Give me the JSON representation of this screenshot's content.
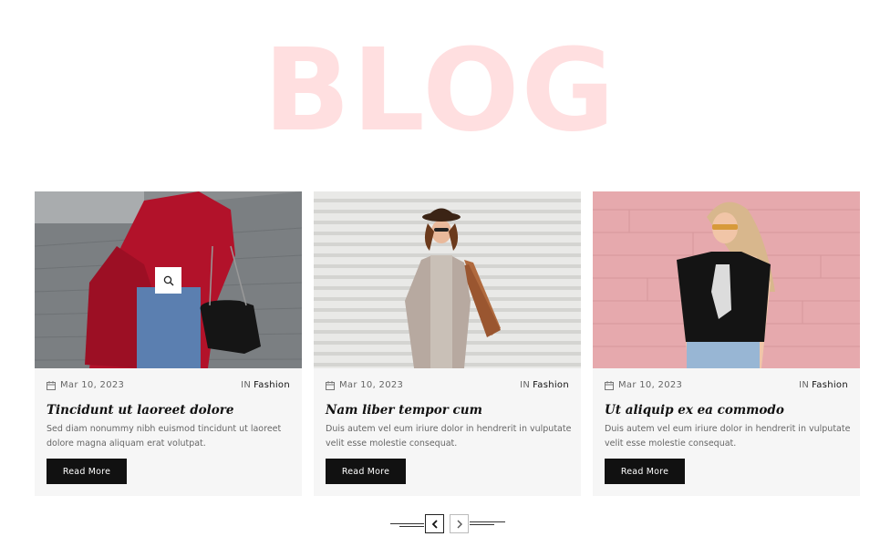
{
  "hero": {
    "title": "BLOG"
  },
  "posts": [
    {
      "date": "Mar 10, 2023",
      "in_label": "IN",
      "category": "Fashion",
      "title": "Tincidunt ut laoreet dolore",
      "excerpt": "Sed diam nonummy nibh euismod tincidunt ut laoreet dolore magna aliquam erat volutpat.",
      "button": "Read More",
      "image": "woman-red-coat-photo",
      "zoom_icon": "search-icon"
    },
    {
      "date": "Mar 10, 2023",
      "in_label": "IN",
      "category": "Fashion",
      "title": "Nam liber tempor cum",
      "excerpt": "Duis autem vel eum iriure dolor in hendrerit in vulputate velit esse molestie consequat.",
      "button": "Read More",
      "image": "woman-hat-shopping-bag-photo"
    },
    {
      "date": "Mar 10, 2023",
      "in_label": "IN",
      "category": "Fashion",
      "title": "Ut aliquip ex ea commodo",
      "excerpt": "Duis autem vel eum iriure dolor in hendrerit in vulputate velit esse molestie consequat.",
      "button": "Read More",
      "image": "woman-pink-wall-photo"
    }
  ],
  "pagination": {
    "prev_icon": "chevron-left-icon",
    "next_icon": "chevron-right-icon"
  },
  "colors": {
    "hero": "#ffdfe0",
    "button_bg": "#111111",
    "card_bg": "#f6f6f6"
  }
}
